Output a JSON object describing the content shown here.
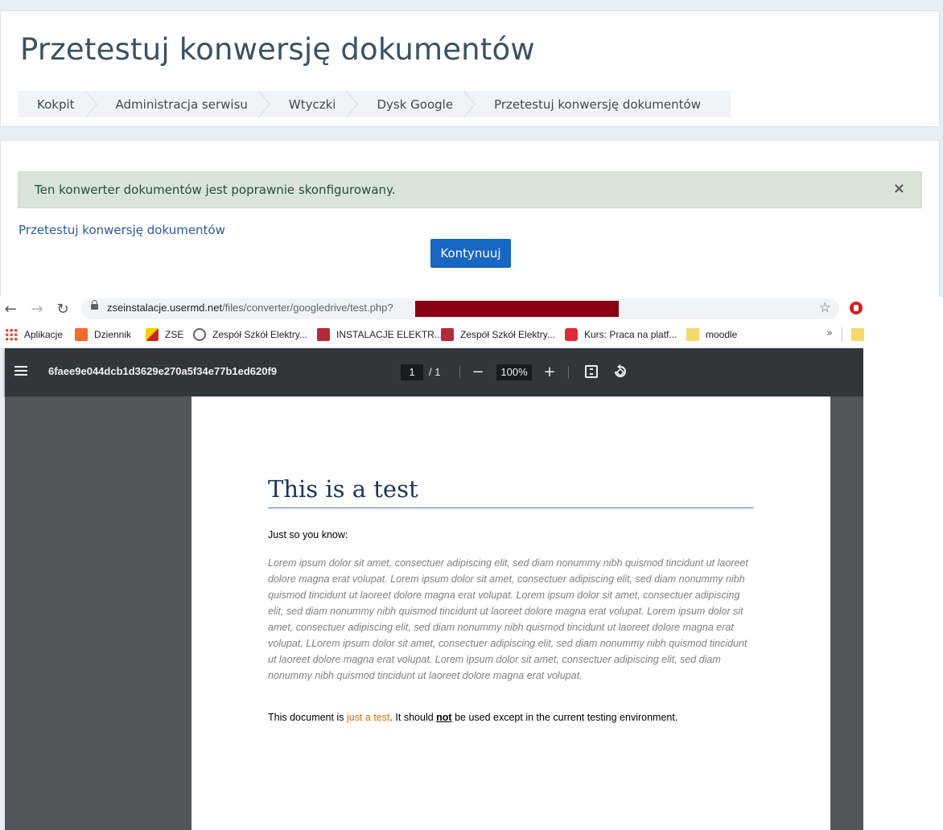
{
  "moodle": {
    "page_title": "Przetestuj konwersję dokumentów",
    "breadcrumb": [
      "Kokpit",
      "Administracja serwisu",
      "Wtyczki",
      "Dysk Google",
      "Przetestuj konwersję dokumentów"
    ],
    "alert": {
      "message": "Ten konwerter dokumentów jest poprawnie skonfigurowany.",
      "close": "×"
    },
    "test_link": "Przetestuj konwersję dokumentów",
    "continue_button": "Kontynuuj"
  },
  "browser": {
    "url_host": "zseinstalacje.usermd.net",
    "url_path": "/files/converter/googledrive/test.php",
    "url_suffix": "?",
    "bookmarks": [
      {
        "label": "Aplikacje",
        "icon": "apps-icon"
      },
      {
        "label": "Dziennik",
        "icon": "dziennik-icon"
      },
      {
        "label": "ZSE",
        "icon": "zse-icon"
      },
      {
        "label": "Zespół Szkół Elektry...",
        "icon": "globe-icon"
      },
      {
        "label": "INSTALACJE ELEKTR...",
        "icon": "site-icon"
      },
      {
        "label": "Zespół Szkół Elektry...",
        "icon": "site-icon"
      },
      {
        "label": "Kurs: Praca na platf...",
        "icon": "moodle-icon"
      },
      {
        "label": "moodle",
        "icon": "folder-icon"
      }
    ],
    "bookmarks_more": "»"
  },
  "pdf": {
    "filename": "6faee9e044dcb1d3629e270a5f34e77b1ed620f9",
    "page_current": "1",
    "page_total": "/  1",
    "zoom": "100%",
    "zoom_out": "−",
    "zoom_in": "+",
    "document": {
      "heading": "This is a test",
      "intro": "Just so you know:",
      "lorem": "Lorem ipsum dolor sit amet, consectuer adipiscing elit, sed diam nonummy nibh quismod tincidunt ut laoreet dolore magna erat volupat.  Lorem ipsum dolor sit amet, consectuer adipiscing elit, sed diam nonummy nibh quismod tincidunt ut laoreet dolore magna erat volupat.  Lorem ipsum dolor sit amet, consectuer adipiscing elit, sed diam nonummy nibh quismod tincidunt ut laoreet dolore magna erat volupat.  Lorem ipsum dolor sit amet, consectuer adipiscing elit, sed diam nonummy nibh quismod tincidunt ut laoreet dolore magna erat volupat.  LLorem ipsum dolor sit amet, consectuer adipiscing elit, sed diam nonummy nibh quismod tincidunt ut laoreet dolore magna erat volupat.  Lorem ipsum dolor sit amet, consectuer adipiscing elit, sed diam nonummy nibh quismod tincidunt ut laoreet dolore magna erat volupat.",
      "final_prefix": "This document is ",
      "final_highlight": "just a test",
      "final_middle": ". It should ",
      "final_emphasis": "not",
      "final_suffix": " be used except in the current testing environment."
    }
  },
  "colors": {
    "alert_bg": "#d8e5d8",
    "button_bg": "#1666c3",
    "link": "#2a5a9c",
    "redaction": "#8b0012",
    "pdf_toolbar": "#323639",
    "pdf_background": "#525659",
    "doc_heading": "#17365d",
    "doc_highlight": "#e36c0a"
  }
}
